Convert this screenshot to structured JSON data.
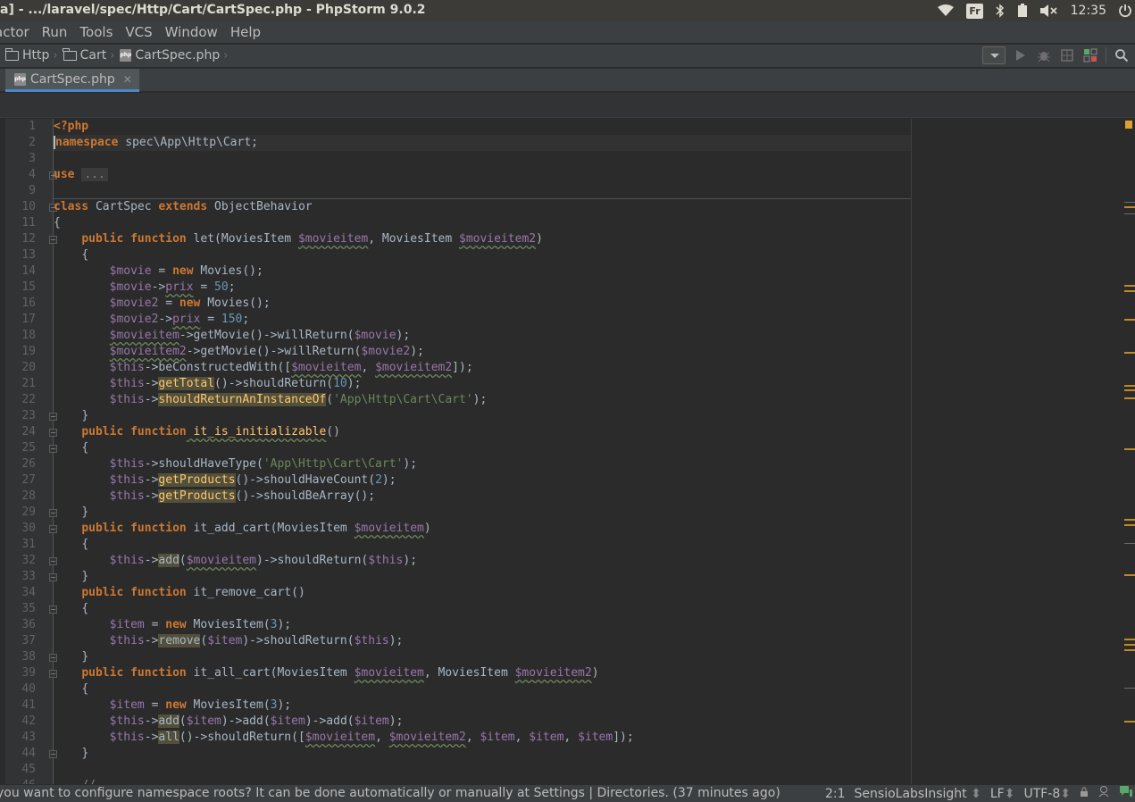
{
  "window": {
    "title": "a] - .../laravel/spec/Http/Cart/CartSpec.php - PhpStorm 9.0.2"
  },
  "tray": {
    "keyboard_layout": "Fr",
    "clock": "12:35",
    "icons": [
      "wifi-icon",
      "keyboard-layout-badge",
      "bluetooth-icon",
      "battery-icon",
      "volume-muted-icon",
      "power-icon"
    ]
  },
  "menu": {
    "items": [
      "actor",
      "Run",
      "Tools",
      "VCS",
      "Window",
      "Help"
    ]
  },
  "breadcrumb": {
    "items": [
      "Http",
      "Cart",
      "CartSpec.php"
    ]
  },
  "tabs": [
    {
      "label": "CartSpec.php",
      "active": true
    }
  ],
  "editor": {
    "line_numbers": [
      "1",
      "2",
      "3",
      "4",
      "9",
      "10",
      "11",
      "12",
      "13",
      "14",
      "15",
      "16",
      "17",
      "18",
      "19",
      "20",
      "21",
      "22",
      "23",
      "24",
      "25",
      "26",
      "27",
      "28",
      "29",
      "30",
      "31",
      "32",
      "33",
      "34",
      "35",
      "36",
      "37",
      "38",
      "39",
      "40",
      "41",
      "42",
      "43",
      "44",
      "45",
      "46"
    ],
    "tokens": {
      "l1": "<?php",
      "l2a": "namespace",
      "l2b": " spec\\App\\Http\\Cart;",
      "l4a": "use",
      "l4b": "...",
      "l10a": "class",
      "l10b": " CartSpec ",
      "l10c": "extends",
      "l10d": " ObjectBehavior",
      "l11": "{",
      "l12a": "public",
      "l12b": "function",
      "l12c": " let(MoviesItem ",
      "l12d": "$movieitem",
      "l12e": ", MoviesItem ",
      "l12f": "$movieitem2",
      "l12g": ")",
      "l13": "{",
      "l14a": "$movie",
      "l14b": " = ",
      "l14c": "new",
      "l14d": " Movies();",
      "l15a": "$movie",
      "l15b": "->",
      "l15c": "prix",
      "l15d": " = ",
      "l15e": "50",
      "l15f": ";",
      "l16a": "$movie2",
      "l16b": " = ",
      "l16c": "new",
      "l16d": " Movies();",
      "l17a": "$movie2",
      "l17b": "->",
      "l17c": "prix",
      "l17d": " = ",
      "l17e": "150",
      "l17f": ";",
      "l18a": "$movieitem",
      "l18b": "->getMovie()->willReturn(",
      "l18c": "$movie",
      "l18d": ");",
      "l19a": "$movieitem2",
      "l19b": "->getMovie()->willReturn(",
      "l19c": "$movie2",
      "l19d": ");",
      "l20a": "$this",
      "l20b": "->beConstructedWith([",
      "l20c": "$movieitem",
      "l20d": ", ",
      "l20e": "$movieitem2",
      "l20f": "]);",
      "l21a": "$this",
      "l21b": "->",
      "l21c": "getTotal",
      "l21d": "()->shouldReturn(",
      "l21e": "10",
      "l21f": ");",
      "l22a": "$this",
      "l22b": "->",
      "l22c": "shouldReturnAnInstanceOf",
      "l22d": "(",
      "l22e": "'App\\Http\\Cart\\Cart'",
      "l22f": ");",
      "l23": "}",
      "l24a": "public",
      "l24b": "function",
      "l24c": " it_is_initializable",
      "l24d": "()",
      "l25": "{",
      "l26a": "$this",
      "l26b": "->shouldHaveType(",
      "l26c": "'App\\Http\\Cart\\Cart'",
      "l26d": ");",
      "l27a": "$this",
      "l27b": "->",
      "l27c": "getProducts",
      "l27d": "()->shouldHaveCount(",
      "l27e": "2",
      "l27f": ");",
      "l28a": "$this",
      "l28b": "->",
      "l28c": "getProducts",
      "l28d": "()->shouldBeArray();",
      "l29": "}",
      "l30a": "public",
      "l30b": "function",
      "l30c": " it_add_cart(MoviesItem ",
      "l30d": "$movieitem",
      "l30e": ")",
      "l31": "{",
      "l32a": "$this",
      "l32b": "->",
      "l32c": "add",
      "l32d": "(",
      "l32e": "$movieitem",
      "l32f": ")->shouldReturn(",
      "l32g": "$this",
      "l32h": ");",
      "l33": "}",
      "l34a": "public",
      "l34b": "function",
      "l34c": " it_remove_cart()",
      "l35": "{",
      "l36a": "$item",
      "l36b": " = ",
      "l36c": "new",
      "l36d": " MoviesItem(",
      "l36e": "3",
      "l36f": ");",
      "l37a": "$this",
      "l37b": "->",
      "l37c": "remove",
      "l37d": "(",
      "l37e": "$item",
      "l37f": ")->shouldReturn(",
      "l37g": "$this",
      "l37h": ");",
      "l38": "}",
      "l39a": "public",
      "l39b": "function",
      "l39c": " it_all_cart(MoviesItem ",
      "l39d": "$movieitem",
      "l39e": ", MoviesItem ",
      "l39f": "$movieitem2",
      "l39g": ")",
      "l40": "{",
      "l41a": "$item",
      "l41b": " = ",
      "l41c": "new",
      "l41d": " MoviesItem(",
      "l41e": "3",
      "l41f": ");",
      "l42a": "$this",
      "l42b": "->",
      "l42c": "add",
      "l42d": "(",
      "l42e": "$item",
      "l42f": ")->add(",
      "l42g": "$item",
      "l42h": ")->add(",
      "l42i": "$item",
      "l42j": ");",
      "l43a": "$this",
      "l43b": "->",
      "l43c": "all",
      "l43d": "()->shouldReturn([",
      "l43e": "$movieitem",
      "l43f": ", ",
      "l43g": "$movieitem2",
      "l43h": ", ",
      "l43i": "$item",
      "l43j": ", ",
      "l43k": "$item",
      "l43l": ", ",
      "l43m": "$item",
      "l43n": "]);",
      "l44": "}",
      "l46": "//"
    }
  },
  "status": {
    "message": "you want to configure namespace roots? It can be done automatically or manually at Settings | Directories. (37 minutes ago)",
    "position": "2:1",
    "inspector": "SensioLabsInsight",
    "line_separator": "LF",
    "encoding": "UTF-8"
  },
  "colors": {
    "editor_bg": "#2b2b2b",
    "keyword": "#cc7832",
    "variable": "#9876aa",
    "method": "#ffc66d",
    "string": "#6a8759",
    "number": "#6897bb",
    "default_text": "#a9b7c6"
  }
}
